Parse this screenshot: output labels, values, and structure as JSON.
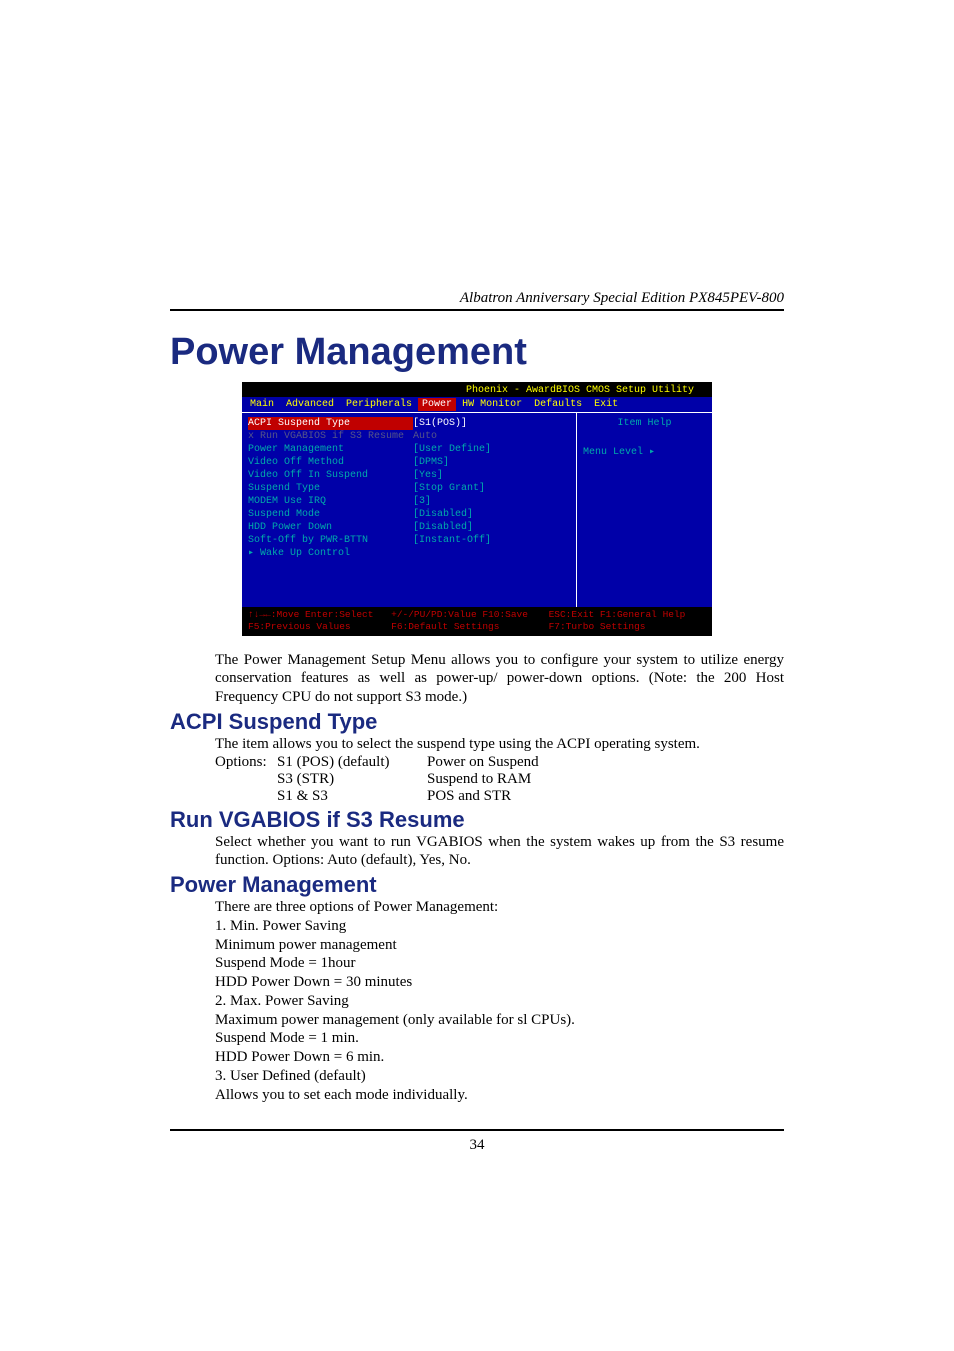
{
  "header": {
    "product": "Albatron Anniversary Special Edition PX845PEV-800"
  },
  "title": "Power Management",
  "bios": {
    "utility_title": "Phoenix - AwardBIOS CMOS Setup Utility",
    "menu": [
      "Main",
      "Advanced",
      "Peripherals",
      "Power",
      "HW Monitor",
      "Defaults",
      "Exit"
    ],
    "selected_menu": "Power",
    "items": [
      {
        "label": "ACPI Suspend Type",
        "value": "[S1(POS)]",
        "selected": true
      },
      {
        "label": "x Run VGABIOS if S3 Resume",
        "value": "Auto",
        "disabled": true
      },
      {
        "label": "  Power Management",
        "value": "[User Define]"
      },
      {
        "label": "  Video Off Method",
        "value": "[DPMS]"
      },
      {
        "label": "  Video Off In Suspend",
        "value": "[Yes]"
      },
      {
        "label": "  Suspend Type",
        "value": "[Stop Grant]"
      },
      {
        "label": "  MODEM Use IRQ",
        "value": "[3]"
      },
      {
        "label": "  Suspend Mode",
        "value": "[Disabled]"
      },
      {
        "label": "  HDD Power Down",
        "value": "[Disabled]"
      },
      {
        "label": "  Soft-Off by PWR-BTTN",
        "value": "[Instant-Off]"
      },
      {
        "label": "▸ Wake Up Control",
        "value": ""
      }
    ],
    "help_title": "Item Help",
    "menu_level": "Menu Level   ▸",
    "footer": {
      "l1a": "↑↓→←:Move  Enter:Select",
      "l1b": "+/-/PU/PD:Value  F10:Save",
      "l1c": "ESC:Exit  F1:General Help",
      "l2a": "F5:Previous Values",
      "l2b": "F6:Default Settings",
      "l2c": "F7:Turbo Settings"
    }
  },
  "intro": "The Power Management Setup Menu allows you to configure your system to utilize energy conservation features as well as power-up/ power-down options. (Note: the 200 Host Frequency CPU do not support S3 mode.)",
  "sections": {
    "acpi": {
      "heading": "ACPI Suspend Type",
      "text": "The item allows you to select the suspend type using the ACPI operating system.",
      "options_label": "Options:",
      "rows": [
        {
          "opt": "S1 (POS) (default)",
          "desc": "Power on Suspend"
        },
        {
          "opt": "S3 (STR)",
          "desc": "Suspend to RAM"
        },
        {
          "opt": "S1 & S3",
          "desc": "POS and STR"
        }
      ]
    },
    "vgabios": {
      "heading": "Run VGABIOS if S3 Resume",
      "text": "Select whether you want to run VGABIOS when the system wakes up from the S3 resume function. Options: Auto (default), Yes, No."
    },
    "pm": {
      "heading": "Power Management",
      "lines": [
        "There are three options of Power Management:",
        "1. Min. Power Saving",
        "Minimum power management",
        "Suspend Mode = 1hour",
        "HDD Power Down = 30 minutes",
        "2. Max. Power Saving",
        "Maximum power management (only available for sl CPUs).",
        "Suspend Mode = 1 min.",
        "HDD Power Down = 6 min.",
        "3. User Defined (default)",
        "Allows you to set each mode individually."
      ]
    }
  },
  "page_number": "34"
}
